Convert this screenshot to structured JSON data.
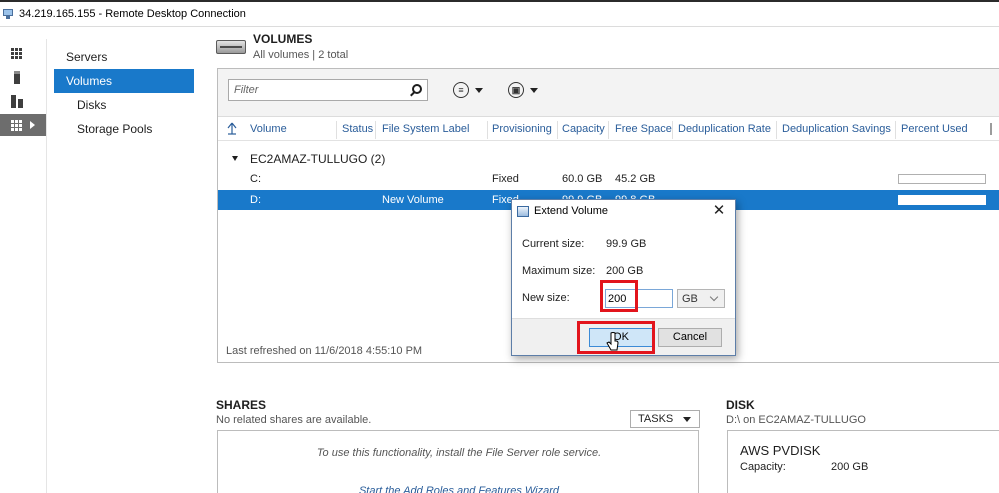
{
  "window": {
    "title": "34.219.165.155 - Remote Desktop Connection"
  },
  "nav": {
    "items": [
      {
        "label": "Servers",
        "level": 0,
        "selected": false
      },
      {
        "label": "Volumes",
        "level": 0,
        "selected": true
      },
      {
        "label": "Disks",
        "level": 1,
        "selected": false
      },
      {
        "label": "Storage Pools",
        "level": 1,
        "selected": false
      }
    ]
  },
  "volumes": {
    "title": "VOLUMES",
    "subtitle": "All volumes | 2 total",
    "filter_placeholder": "Filter",
    "columns": [
      "Volume",
      "Status",
      "File System Label",
      "Provisioning",
      "Capacity",
      "Free Space",
      "Deduplication Rate",
      "Deduplication Savings",
      "Percent Used"
    ],
    "group": "EC2AMAZ-TULLUGO (2)",
    "rows": [
      {
        "volume": "C:",
        "status": "",
        "label": "",
        "provisioning": "Fixed",
        "capacity": "60.0 GB",
        "free": "45.2 GB",
        "percent_used": 0.25,
        "selected": false
      },
      {
        "volume": "D:",
        "status": "",
        "label": "New Volume",
        "provisioning": "Fixed",
        "capacity": "99.9 GB",
        "free": "99.8 GB",
        "percent_used": 0.0,
        "selected": true
      }
    ],
    "last_refreshed": "Last refreshed on 11/6/2018 4:55:10 PM"
  },
  "shares": {
    "title": "SHARES",
    "subtitle": "No related shares are available.",
    "tasks_label": "TASKS",
    "message": "To use this functionality, install the File Server role service.",
    "link": "Start the Add Roles and Features Wizard"
  },
  "disk": {
    "title": "DISK",
    "subtitle": "D:\\ on EC2AMAZ-TULLUGO",
    "name": "AWS PVDISK",
    "capacity_label": "Capacity:",
    "capacity_value": "200 GB"
  },
  "dialog": {
    "title": "Extend Volume",
    "current_label": "Current size:",
    "current_value": "99.9 GB",
    "max_label": "Maximum size:",
    "max_value": "200 GB",
    "new_label": "New size:",
    "new_value": "200",
    "unit": "GB",
    "ok_label": "OK",
    "cancel_label": "Cancel"
  },
  "colors": {
    "accent": "#1979ca",
    "usage_fill": "#13b413",
    "highlight": "#e2141c"
  }
}
